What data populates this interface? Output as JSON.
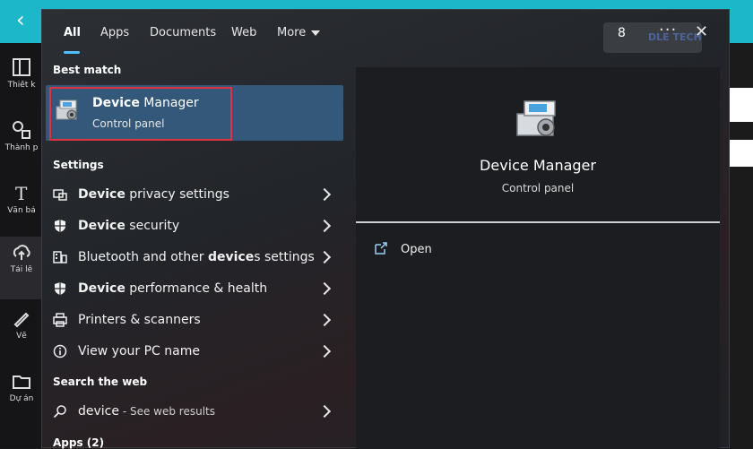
{
  "background": {
    "sidebar_labels": [
      "Thiết k",
      "Thành p",
      "Văn bả",
      "Tải lê",
      "Vẽ",
      "Dự án"
    ]
  },
  "tabs": [
    {
      "label": "All",
      "active": true
    },
    {
      "label": "Apps"
    },
    {
      "label": "Documents"
    },
    {
      "label": "Web"
    },
    {
      "label": "More"
    }
  ],
  "header": {
    "badge_count": "8",
    "watermark": "DLE TECH",
    "more_options": "···",
    "close": "✕"
  },
  "best_match": {
    "heading": "Best match",
    "title_bold": "Device",
    "title_rest": " Manager",
    "subtitle": "Control panel"
  },
  "settings": {
    "heading": "Settings",
    "items": [
      {
        "bold": "Device",
        "rest": " privacy settings",
        "icon": "privacy-icon"
      },
      {
        "bold": "Device",
        "rest": " security",
        "icon": "shield-icon"
      },
      {
        "pre": "Bluetooth and other ",
        "bold": "device",
        "rest": "s settings",
        "icon": "bluetooth-devices-icon"
      },
      {
        "bold": "Device",
        "rest": " performance & health",
        "icon": "shield-icon"
      },
      {
        "pre": "Printers & scanners",
        "icon": "printer-icon"
      },
      {
        "pre": "View your PC name",
        "icon": "info-icon"
      }
    ]
  },
  "search_web": {
    "heading": "Search the web",
    "query": "device",
    "suffix": " - See web results"
  },
  "apps_heading": "Apps (2)",
  "detail": {
    "title": "Device Manager",
    "subtitle": "Control panel",
    "open_label": "Open"
  }
}
